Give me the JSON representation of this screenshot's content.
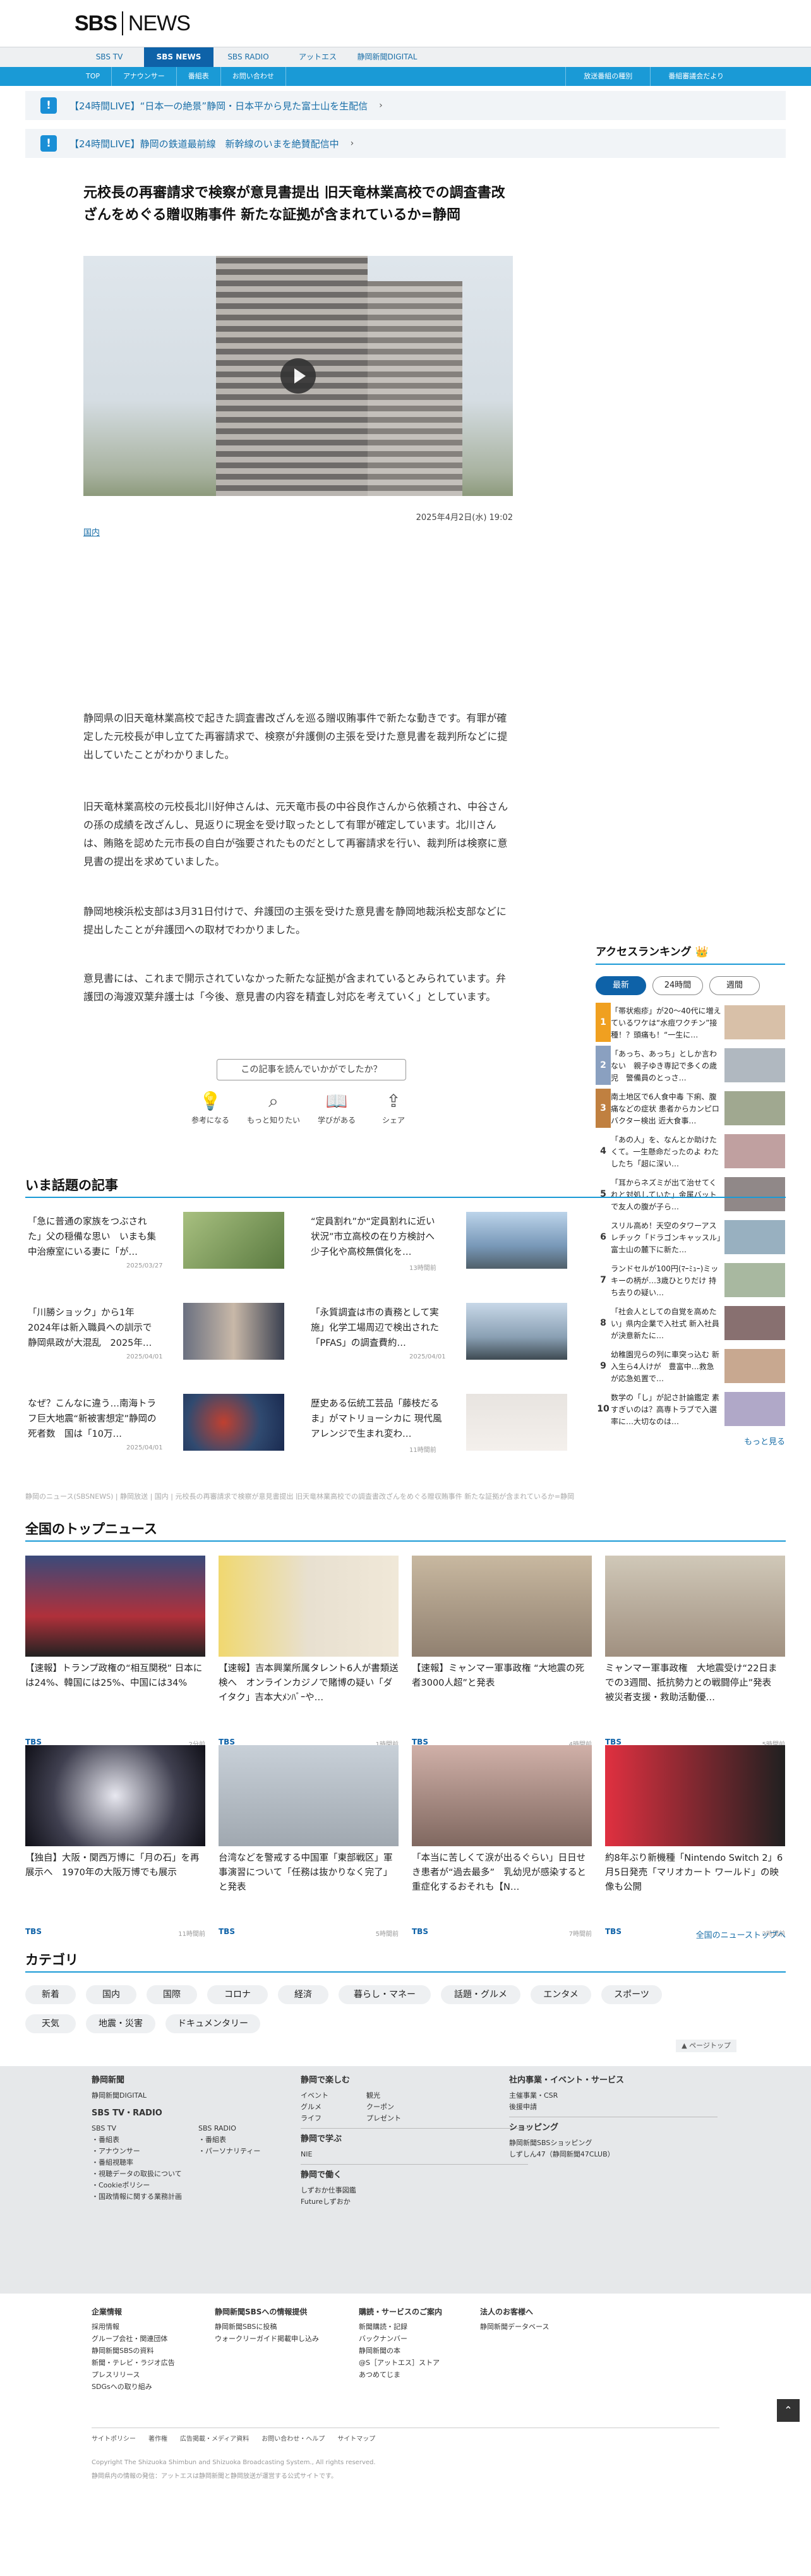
{
  "brand": {
    "logo_left": "SBS",
    "logo_right": "NEWS"
  },
  "nav1": [
    "SBS TV",
    "SBS NEWS",
    "SBS RADIO",
    "アットエス",
    "静岡新聞DIGITAL"
  ],
  "nav2": {
    "items": [
      "TOP",
      "アナウンサー",
      "番組表",
      "お問い合わせ"
    ],
    "right": [
      "放送番組の種別",
      "番組審議会だより"
    ]
  },
  "live": [
    "【24時間LIVE】“日本一の絶景”静岡・日本平から見た富士山を生配信",
    "【24時間LIVE】静岡の鉄道最前線　新幹線のいまを絶賛配信中"
  ],
  "article": {
    "title": "元校長の再審請求で検察が意見書提出 旧天竜林業高校での調査書改ざんをめぐる贈収賄事件 新たな証拠が含まれているか=静岡",
    "date": "2025年4月2日(水) 19:02",
    "category": "国内",
    "paragraphs": [
      "静岡県の旧天竜林業高校で起きた調査書改ざんを巡る贈収賄事件で新たな動きです。有罪が確定した元校長が申し立てた再審請求で、検察が弁護側の主張を受けた意見書を裁判所などに提出していたことがわかりました。",
      "旧天竜林業高校の元校長北川好伸さんは、元天竜市長の中谷良作さんから依頼され、中谷さんの孫の成績を改ざんし、見返りに現金を受け取ったとして有罪が確定しています。北川さんは、賄賂を認めた元市長の自白が強要されたものだとして再審請求を行い、裁判所は検察に意見書の提出を求めていました。",
      "静岡地検浜松支部は3月31日付けで、弁護団の主張を受けた意見書を静岡地裁浜松支部などに提出したことが弁護団への取材でわかりました。",
      "意見書には、これまで開示されていなかった新たな証拠が含まれているとみられています。弁護団の海渡双葉弁護士は「今後、意見書の内容を精査し対応を考えていく」としています。"
    ],
    "feedback_q": "この記事を読んでいかがでしたか？",
    "feedback": [
      "参考になる",
      "もっと知りたい",
      "学びがある",
      "シェア"
    ]
  },
  "topics": {
    "title": "いま話題の記事",
    "items": [
      {
        "text": "「急に普通の家族をつぶされた」父の穏備な思い　いまも集中治療室にいる妻に「が…",
        "date": "2025/03/27"
      },
      {
        "text": "“定員割れ”か“定員割れに近い状況”市立高校の在り方検討へ 少子化や高校無償化を…",
        "date": "13時間前"
      },
      {
        "text": "「川勝ショック」から1年　2024年は新入職員への訓示で静岡県政が大混乱　2025年…",
        "date": "2025/04/01"
      },
      {
        "text": "「永質調査は市の責務として実施」化学工場周辺で検出された「PFAS」の調査費約…",
        "date": "2025/04/01"
      },
      {
        "text": "なぜ？こんなに違う…南海トラフ巨大地震“新被害想定”静岡の死者数　国は「10万…",
        "date": "2025/04/01"
      },
      {
        "text": "歴史ある伝統工芸品「藤枝だるま」がマトリョーシカに 現代風アレンジで生まれ変わ…",
        "date": "11時間前"
      }
    ]
  },
  "breadcrumb": "静岡のニュース(SBSNEWS) | 静岡放送 | 国内 | 元校長の再審請求で検察が意見書提出 旧天竜林業高校での調査書改ざんをめぐる贈収賄事件 新たな証拠が含まれているか=静岡",
  "ranking": {
    "title": "アクセスランキング",
    "tabs": [
      "最新",
      "24時間",
      "週間"
    ],
    "items": [
      "「帯状疱疹」が20〜40代に増えているワケは“水痘ワクチン”接種！？頭痛も！“一生に…",
      "「あっち、あっち」としか言わない　親子ゆき専記で多くの歳児　警備員のとっさ…",
      "南土地区で6人食中毒 下痢、腹痛などの症状 患者からカンピロバクター検出 近大食事…",
      "「あの人」を、なんとか助けたくて。一生懸命だったのよ わたしたち「超に深い…",
      "「耳からネズミが出て治せてくれと対処していた」金属バットで友人の腹が子ら…",
      "スリル高め！天空のタワーアスレチック「ドラゴンキャッスル」富士山の麓下に新た…",
      "ランドセルが100円(ﾏｰﾐｭｰ)ミッキーの柄が…3歳ひとりだけ 持ち去りの疑い…",
      "「社会人としての自覚を高めたい」県内企業で入社式 新入社員が決意新たに…",
      "幼稚園児らの列に車突っ込む 新入生ら4人けが　豊富中…救急が応急処置で…",
      "数学の「し」が記さ計論鑑定 素すぎいのは？高専トラブで入選率に…大切なのは…"
    ],
    "more": "もっと見る"
  },
  "top_news": {
    "title": "全国のトップニュース",
    "items": [
      {
        "text": "【速報】トランプ政権の“相互関税” 日本には24%、韓国には25%、中国には34%",
        "time": "2分前"
      },
      {
        "text": "【速報】吉本興業所属タレント6人が書類送検へ　オンラインカジノで賭博の疑い「ダイタク」吉本大ﾒﾝﾊﾞｰや…",
        "time": "1時間前"
      },
      {
        "text": "【速報】ミャンマー軍事政権 “大地震の死者3000人超”と発表",
        "time": "4時間前"
      },
      {
        "text": "ミャンマー軍事政権　大地震受け“22日までの3週間、抵抗勢力との戦闘停止”発表　被災者支援・救助活動優…",
        "time": "5時間前"
      },
      {
        "text": "【独自】大阪・関西万博に「月の石」を再展示へ　1970年の大阪万博でも展示",
        "time": "11時間前"
      },
      {
        "text": "台湾などを警戒する中国軍「東部戦区」軍事演習について「任務は抜かりなく完了」と発表",
        "time": "5時間前"
      },
      {
        "text": "「本当に苦しくて涙が出るぐらい」日日せき患者が“過去最多”　乳幼児が感染すると重症化するおそれも【N…",
        "time": "7時間前"
      },
      {
        "text": "約8年ぶり新機種「Nintendo Switch 2」6月5日発売「マリオカート ワールド」の映像も公開",
        "time": "2時間前"
      }
    ],
    "badge": "TBS",
    "more": "全国のニューストップへ"
  },
  "categories": {
    "title": "カテゴリ",
    "items": [
      "新着",
      "国内",
      "国際",
      "コロナ",
      "経済",
      "暮らし・マネー",
      "話題・グルメ",
      "エンタメ",
      "スポーツ",
      "天気",
      "地震・災害",
      "ドキュメンタリー"
    ]
  },
  "pagetop": "ページトップ",
  "footer": {
    "shizuoka": {
      "title": "静岡新聞",
      "links": [
        "静岡新聞DIGITAL"
      ]
    },
    "sbs": {
      "title": "SBS TV・RADIO",
      "col1": [
        "SBS TV",
        "・番組表",
        "・アナウンサー",
        "・番組視聴率",
        "・視聴データの取扱について",
        "・Cookieポリシー",
        "・国政情報に関する業務計画"
      ],
      "col2": [
        "SBS RADIO",
        "・番組表",
        "・パーソナリティー"
      ]
    },
    "enjoy": {
      "title": "静岡で楽しむ",
      "col1": [
        "イベント",
        "グルメ",
        "ライフ"
      ],
      "col2": [
        "観光",
        "クーポン",
        "プレゼント"
      ]
    },
    "learn": {
      "title": "静岡で学ぶ",
      "links": [
        "NIE"
      ]
    },
    "work": {
      "title": "静岡で働く",
      "links": [
        "しずおか仕事図鑑",
        "Futureしずおか"
      ]
    },
    "corp": {
      "title": "社内事業・イベント・サービス",
      "links": [
        "主催事業・CSR",
        "後援申請"
      ]
    },
    "shop": {
      "title": "ショッピング",
      "links": [
        "静岡新聞SBSショッピング",
        "しずしん47（静岡新聞47CLUB）"
      ]
    }
  },
  "bottom": {
    "c1": {
      "title": "企業情報",
      "links": [
        "採用情報",
        "グループ会社・関連団体",
        "静岡新聞SBSの資料",
        "新聞・テレビ・ラジオ広告",
        "プレスリリース",
        "SDGsへの取り組み"
      ]
    },
    "c2": {
      "title": "静岡新聞SBSへの情報提供",
      "links": [
        "静岡新聞SBSに投稿",
        "ウォークリーガイド掲載申し込み"
      ]
    },
    "c3": {
      "title": "購読・サービスのご案内",
      "links": [
        "新聞購読・記録",
        "バックナンバー",
        "静岡新聞の本",
        "@S［アットエス］ストア",
        "あつめてじま"
      ]
    },
    "c4": {
      "title": "法人のお客様へ",
      "links": [
        "静岡新聞データベース"
      ]
    },
    "links": [
      "サイトポリシー",
      "著作権",
      "広告掲載・メディア資料",
      "お問い合わせ・ヘルプ",
      "サイトマップ"
    ],
    "copyright": "Copyright The Shizuoka Shimbun and Shizuoka Broadcasting System., All rights reserved.",
    "note": "静岡県内の情報の発信：アットエスは静岡新聞と静岡放送が運営する公式サイトです。"
  },
  "colors": {
    "accent": "#1a9ad6",
    "brand": "#0e62a8"
  }
}
